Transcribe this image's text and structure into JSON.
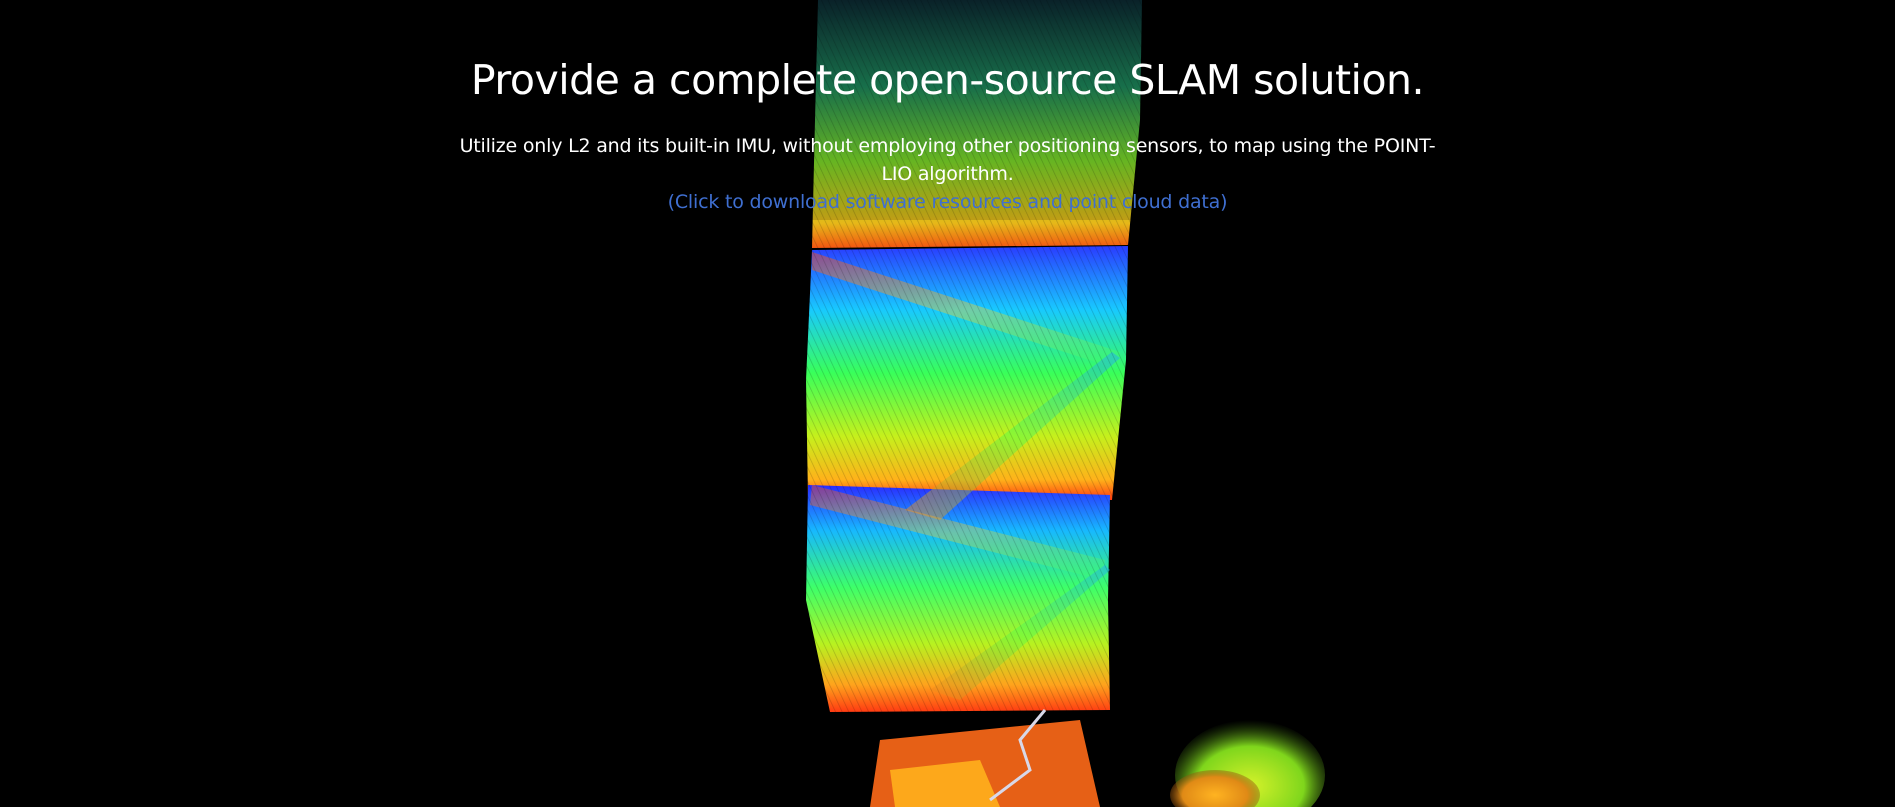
{
  "hero": {
    "title": "Provide a complete open-source SLAM solution.",
    "subtitle": "Utilize only L2 and its built-in IMU, without employing other positioning sensors, to map using the POINT-LIO algorithm.",
    "download_link": "(Click to download software resources and point cloud data)"
  },
  "colors": {
    "background": "#000000",
    "title": "#ffffff",
    "link": "#3f6fd1"
  },
  "image": {
    "description_icon": "point-cloud-staircase-image"
  }
}
